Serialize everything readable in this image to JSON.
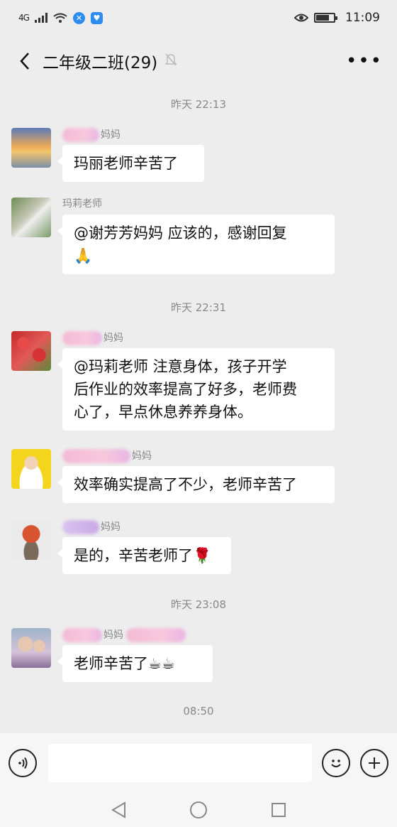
{
  "status": {
    "network": "4G",
    "time": "11:09"
  },
  "header": {
    "title": "二年级二班(29)",
    "back_icon": "chevron-left-icon",
    "mute_icon": "bell-muted-icon",
    "more_label": "•••"
  },
  "messages": [
    {
      "type": "time",
      "text": "昨天 22:13"
    },
    {
      "type": "msg",
      "sender": "妈妈",
      "text": "玛丽老师辛苦了"
    },
    {
      "type": "msg",
      "sender": "玛莉老师",
      "text_lines": [
        "@谢芳芳妈妈  应该的，感谢回复",
        "🙏"
      ]
    },
    {
      "type": "time",
      "text": "昨天 22:31"
    },
    {
      "type": "msg",
      "sender": "妈妈",
      "text_lines": [
        "@玛莉老师  注意身体，孩子开学",
        "后作业的效率提高了好多，老师费",
        "心了，早点休息养养身体。"
      ]
    },
    {
      "type": "msg",
      "sender": "妈妈",
      "text": "效率确实提高了不少，老师辛苦了"
    },
    {
      "type": "msg",
      "sender": "妈妈",
      "text": "是的，辛苦老师了🌹"
    },
    {
      "type": "time",
      "text": "昨天 23:08"
    },
    {
      "type": "msg",
      "sender": "妈妈",
      "text": "老师辛苦了☕☕"
    },
    {
      "type": "time",
      "text": "08:50"
    }
  ],
  "input": {
    "voice_icon": "voice-icon",
    "emoji_icon": "emoji-icon",
    "plus_icon": "plus-icon"
  },
  "nav": {
    "back": "triangle-back-icon",
    "home": "circle-home-icon",
    "recent": "square-recent-icon"
  }
}
